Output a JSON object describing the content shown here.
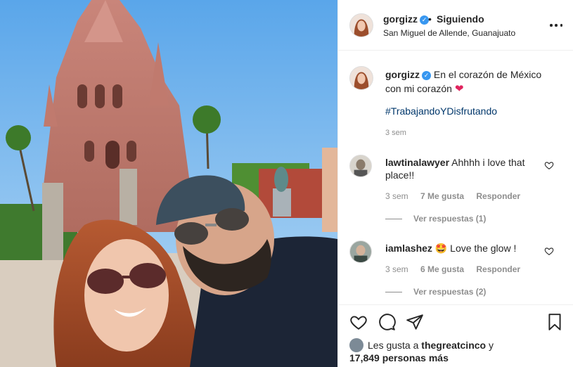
{
  "post": {
    "image_alt": "",
    "header": {
      "username": "gorgizz",
      "separator": "•",
      "following_label": "Siguiendo",
      "location": "San Miguel de Allende, Guanajuato",
      "more_icon": "more-horizontal-icon"
    },
    "caption": {
      "username": "gorgizz",
      "text": "En el corazón de México con mi corazón",
      "emoji": "❤",
      "hashtag": "#TrabajandoYDisfrutando",
      "time": "3 sem"
    },
    "comments": [
      {
        "username": "lawtinalawyer",
        "text": "Ahhhh i love that place!!",
        "time": "3 sem",
        "likes": "7 Me gusta",
        "reply_label": "Responder",
        "view_replies": "Ver respuestas (1)"
      },
      {
        "username": "iamlashez",
        "emoji": "🤩",
        "text": "Love the glow !",
        "time": "3 sem",
        "likes": "6 Me gusta",
        "reply_label": "Responder",
        "view_replies": "Ver respuestas (2)"
      }
    ],
    "actions": {
      "like_icon": "heart-icon",
      "comment_icon": "comment-bubble-icon",
      "share_icon": "paper-plane-icon",
      "save_icon": "bookmark-icon"
    },
    "likes": {
      "prefix": "Les gusta a",
      "user": "thegreatcinco",
      "conjunction": "y",
      "others": "17,849 personas más"
    }
  },
  "colors": {
    "text": "#262626",
    "secondary": "#8e8e8e",
    "link": "#00376b",
    "verified": "#3897f0",
    "heart": "#e0245e",
    "border": "#efefef"
  }
}
